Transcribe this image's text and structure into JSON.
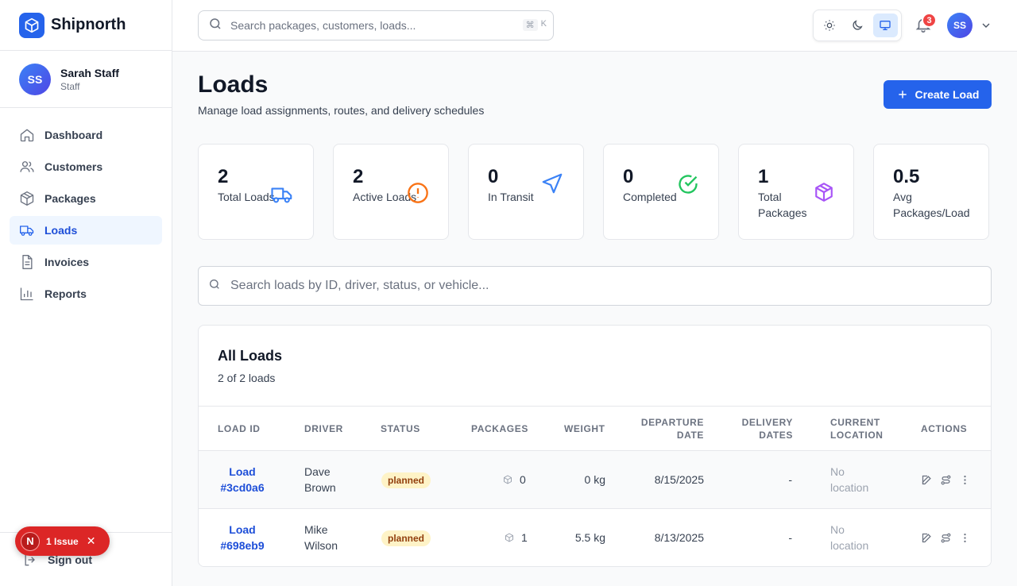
{
  "brand": {
    "name": "Shipnorth",
    "logo_icon": "box-icon",
    "accent": "#2563eb"
  },
  "user": {
    "initials": "SS",
    "name": "Sarah Staff",
    "role": "Staff"
  },
  "sidebar": {
    "items": [
      {
        "label": "Dashboard",
        "icon": "home-icon",
        "active": false
      },
      {
        "label": "Customers",
        "icon": "users-icon",
        "active": false
      },
      {
        "label": "Packages",
        "icon": "package-icon",
        "active": false
      },
      {
        "label": "Loads",
        "icon": "truck-icon",
        "active": true
      },
      {
        "label": "Invoices",
        "icon": "document-icon",
        "active": false
      },
      {
        "label": "Reports",
        "icon": "bar-chart-icon",
        "active": false
      }
    ],
    "sign_out": "Sign out"
  },
  "issue_toast": {
    "initial": "N",
    "label": "1 Issue",
    "color": "#dc2626"
  },
  "topbar": {
    "search_placeholder": "Search packages, customers, loads...",
    "shortcut_key1": "⌘",
    "shortcut_key2": "K",
    "theme_options": [
      "light",
      "dark",
      "system"
    ],
    "theme_selected": "system",
    "notification_count": "3",
    "avatar_initials": "SS"
  },
  "page": {
    "title": "Loads",
    "subtitle": "Manage load assignments, routes, and delivery schedules",
    "create_button": "Create Load"
  },
  "stats": [
    {
      "value": "2",
      "label": "Total Loads",
      "icon": "truck-icon",
      "color": "#3b82f6"
    },
    {
      "value": "2",
      "label": "Active Loads",
      "icon": "alert-circle-icon",
      "color": "#f97316"
    },
    {
      "value": "0",
      "label": "In Transit",
      "icon": "navigation-icon",
      "color": "#3b82f6"
    },
    {
      "value": "0",
      "label": "Completed",
      "icon": "check-circle-icon",
      "color": "#22c55e"
    },
    {
      "value": "1",
      "label": "Total Packages",
      "icon": "package-icon",
      "color": "#a855f7"
    },
    {
      "value": "0.5",
      "label": "Avg Packages/Load",
      "icon": "",
      "color": ""
    }
  ],
  "loads_search_placeholder": "Search loads by ID, driver, status, or vehicle...",
  "table": {
    "title": "All Loads",
    "subtitle": "2 of 2 loads",
    "columns": [
      "Load ID",
      "Driver",
      "Status",
      "Packages",
      "Weight",
      "Departure Date",
      "Delivery Dates",
      "Current Location",
      "Actions"
    ],
    "rows": [
      {
        "load_id": "Load #3cd0a6",
        "driver": "Dave Brown",
        "status": "planned",
        "packages": "0",
        "weight": "0 kg",
        "departure": "8/15/2025",
        "delivery": "-",
        "location": "No location"
      },
      {
        "load_id": "Load #698eb9",
        "driver": "Mike Wilson",
        "status": "planned",
        "packages": "1",
        "weight": "5.5 kg",
        "departure": "8/13/2025",
        "delivery": "-",
        "location": "No location"
      }
    ]
  }
}
